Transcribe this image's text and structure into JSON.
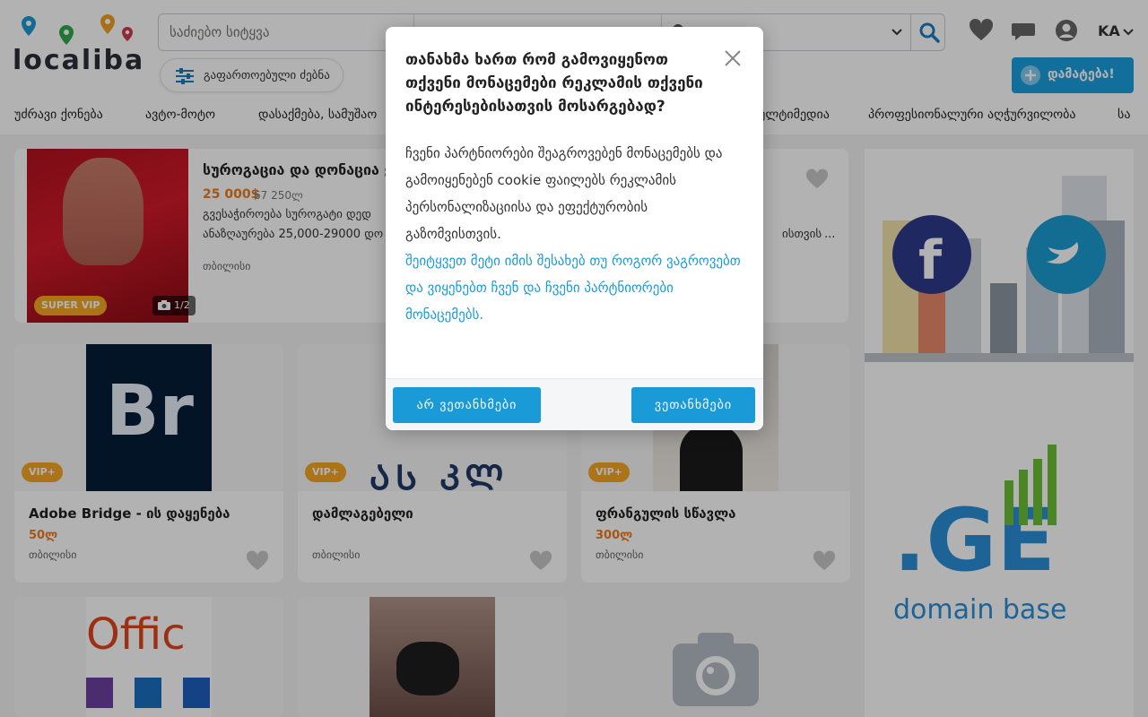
{
  "header": {
    "logo_text": "localiba",
    "search_placeholder": "საძიებო სიტყვა",
    "location_text": "",
    "language": "KA",
    "advanced_search_label": "გაფართოებული ძებნა",
    "add_button_label": "დამატება!"
  },
  "categories": [
    "უძრავი ქონება",
    "ავტო-მოტო",
    "დასაქმება, სამუშაო",
    "ულტიმედია",
    "პროფესიონალური აღჭურვილობა",
    "სა"
  ],
  "featured": {
    "title": "სუროგაცია და დონაცია ყ",
    "price": "25 000$",
    "price_alt": "67 250ლ",
    "desc_line1": "გვესაჭიროება სუროგატი დედ",
    "desc_line2": "ანაზღაურება 25,000-29000 დო",
    "desc_line2_end": "ისთვის",
    "ellipsis": "...",
    "location": "თბილისი",
    "badge": "SUPER VIP",
    "image_count": "1/2"
  },
  "cards": [
    {
      "title": "Adobe Bridge - ის დაყენება",
      "price": "50ლ",
      "location": "თბილისი",
      "badge": "VIP+",
      "image_text": "Br"
    },
    {
      "title": "დამლაგებელი",
      "price": "",
      "location": "თბილისი",
      "badge": "VIP+",
      "image_text": "ᲐᲡ ᲙᲚ"
    },
    {
      "title": "ფრანგულის სწავლა",
      "price": "300ლ",
      "location": "თბილისი",
      "badge": "VIP+",
      "image_text": ""
    }
  ],
  "bottom_cards": [
    {
      "image_text": "Offic"
    },
    {
      "image_text": ""
    },
    {
      "image_text": ""
    }
  ],
  "side_ad": {
    "domain_text": ".GE",
    "domain_sub": "domain base"
  },
  "consent": {
    "title": "თანახმა ხართ რომ გამოვიყენოთ თქვენი მონაცემები რეკლამის თქვენი ინტერესებისათვის მოსარგებად?",
    "body": "ჩვენი პარტნიორები შეაგროვებენ მონაცემებს და გამოიყენებენ cookie ფაილებს რეკლამის პერსონალიზაციისა და ეფექტურობის გაზომვისთვის.",
    "link_text": "შეიტყვეთ მეტი იმის შესახებ თუ როგორ ვაგროვებთ და ვიყენებთ ჩვენ და ჩვენი პარტნიორები მონაცემებს.",
    "reject_label": "არ ვეთანხმები",
    "accept_label": "ვეთანხმები"
  },
  "colors": {
    "accent": "#1a9ad6",
    "price": "#f07a1a",
    "badge": "#f5a623"
  }
}
